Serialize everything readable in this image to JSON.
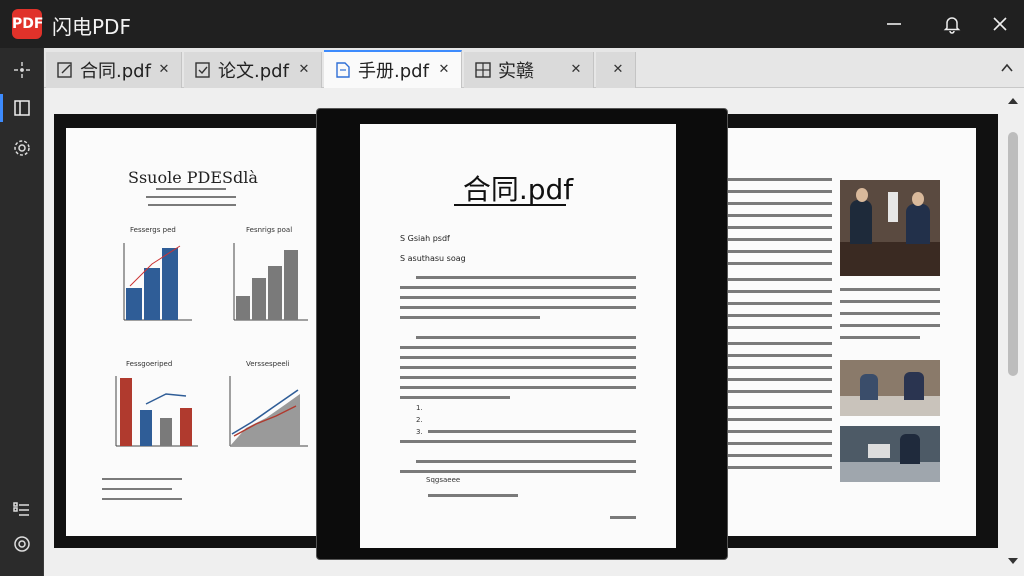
{
  "app": {
    "title": "闪电PDF",
    "logo_text": "PDF"
  },
  "tabs": [
    {
      "label": "合同.pdf",
      "icon": "edit-document-icon",
      "close": "✕"
    },
    {
      "label": "论文.pdf",
      "icon": "checklist-document-icon",
      "close": "✕"
    },
    {
      "label": "手册.pdf",
      "icon": "document-icon",
      "close": "✕"
    },
    {
      "label": "实赣",
      "icon": "grid-document-icon",
      "close": "✕"
    },
    {
      "label": "",
      "icon": "",
      "close": "✕"
    }
  ],
  "sidebar": {
    "items": [
      "sparkle-grid-icon",
      "book-icon",
      "gear-icon",
      "list-icon",
      "settings-icon"
    ]
  },
  "left_page": {
    "title": "Ssuole PDESdlà",
    "chart_labels": [
      "Fessergs ped",
      "Fesnrigs poal",
      "Fessgoeriped",
      "Verssespeeli"
    ]
  },
  "center_page": {
    "title": "合同.pdf",
    "subhead_1": "S Gsiah psdf",
    "subhead_2": "S asuthasu soag",
    "list_items": [
      "1.",
      "2.",
      "3."
    ],
    "footer": "Sqgsaeee"
  },
  "colors": {
    "accent": "#3d8bfd",
    "logo": "#e0322a",
    "bar_blue": "#2f5d97",
    "bar_red": "#b03a2e"
  }
}
